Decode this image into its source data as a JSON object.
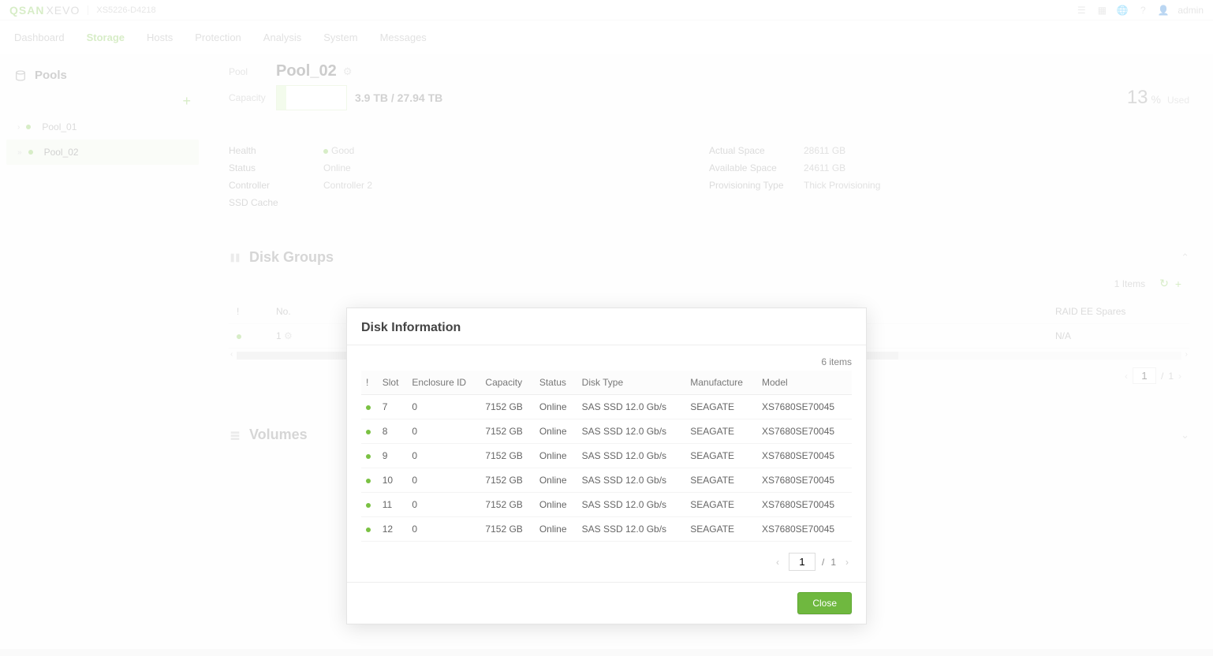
{
  "brand": {
    "main": "QSAN",
    "sub": "XEVO",
    "model": "XS5226-D4218"
  },
  "topbar": {
    "user": "admin"
  },
  "nav": {
    "items": [
      "Dashboard",
      "Storage",
      "Hosts",
      "Protection",
      "Analysis",
      "System",
      "Messages"
    ],
    "active": 1
  },
  "sidebar": {
    "title": "Pools",
    "items": [
      {
        "name": "Pool_01"
      },
      {
        "name": "Pool_02"
      }
    ],
    "active": 1
  },
  "pool": {
    "labels": {
      "pool": "Pool",
      "capacity": "Capacity"
    },
    "name": "Pool_02",
    "capacity_text": "3.9 TB / 27.94 TB",
    "fill_pct": 14,
    "used_pct": "13",
    "used_unit": "%",
    "used_label": "Used",
    "info_left": [
      {
        "k": "Health",
        "v": "Good",
        "dot": true
      },
      {
        "k": "Status",
        "v": "Online"
      },
      {
        "k": "Controller",
        "v": "Controller 2"
      },
      {
        "k": "SSD Cache",
        "v": ""
      }
    ],
    "info_right": [
      {
        "k": "Actual Space",
        "v": "28611 GB"
      },
      {
        "k": "Available Space",
        "v": "24611 GB"
      },
      {
        "k": "Provisioning Type",
        "v": "Thick Provisioning"
      }
    ]
  },
  "disk_groups": {
    "title": "Disk Groups",
    "items_label": "1 Items",
    "headers": {
      "status": "!",
      "no": "No.",
      "raid_spares": "RAID EE Spares"
    },
    "row": {
      "no": "1",
      "raid_spares": "N/A"
    },
    "pager": {
      "page": "1",
      "pages": "1"
    }
  },
  "volumes": {
    "title": "Volumes"
  },
  "modal": {
    "title": "Disk Information",
    "items_text": "6 items",
    "headers": [
      "!",
      "Slot",
      "Enclosure ID",
      "Capacity",
      "Status",
      "Disk Type",
      "Manufacture",
      "Model"
    ],
    "rows": [
      {
        "slot": "7",
        "enc": "0",
        "cap": "7152 GB",
        "status": "Online",
        "type": "SAS SSD 12.0 Gb/s",
        "mfr": "SEAGATE",
        "model": "XS7680SE70045"
      },
      {
        "slot": "8",
        "enc": "0",
        "cap": "7152 GB",
        "status": "Online",
        "type": "SAS SSD 12.0 Gb/s",
        "mfr": "SEAGATE",
        "model": "XS7680SE70045"
      },
      {
        "slot": "9",
        "enc": "0",
        "cap": "7152 GB",
        "status": "Online",
        "type": "SAS SSD 12.0 Gb/s",
        "mfr": "SEAGATE",
        "model": "XS7680SE70045"
      },
      {
        "slot": "10",
        "enc": "0",
        "cap": "7152 GB",
        "status": "Online",
        "type": "SAS SSD 12.0 Gb/s",
        "mfr": "SEAGATE",
        "model": "XS7680SE70045"
      },
      {
        "slot": "11",
        "enc": "0",
        "cap": "7152 GB",
        "status": "Online",
        "type": "SAS SSD 12.0 Gb/s",
        "mfr": "SEAGATE",
        "model": "XS7680SE70045"
      },
      {
        "slot": "12",
        "enc": "0",
        "cap": "7152 GB",
        "status": "Online",
        "type": "SAS SSD 12.0 Gb/s",
        "mfr": "SEAGATE",
        "model": "XS7680SE70045"
      }
    ],
    "pager": {
      "page": "1",
      "pages": "1"
    },
    "close": "Close"
  }
}
